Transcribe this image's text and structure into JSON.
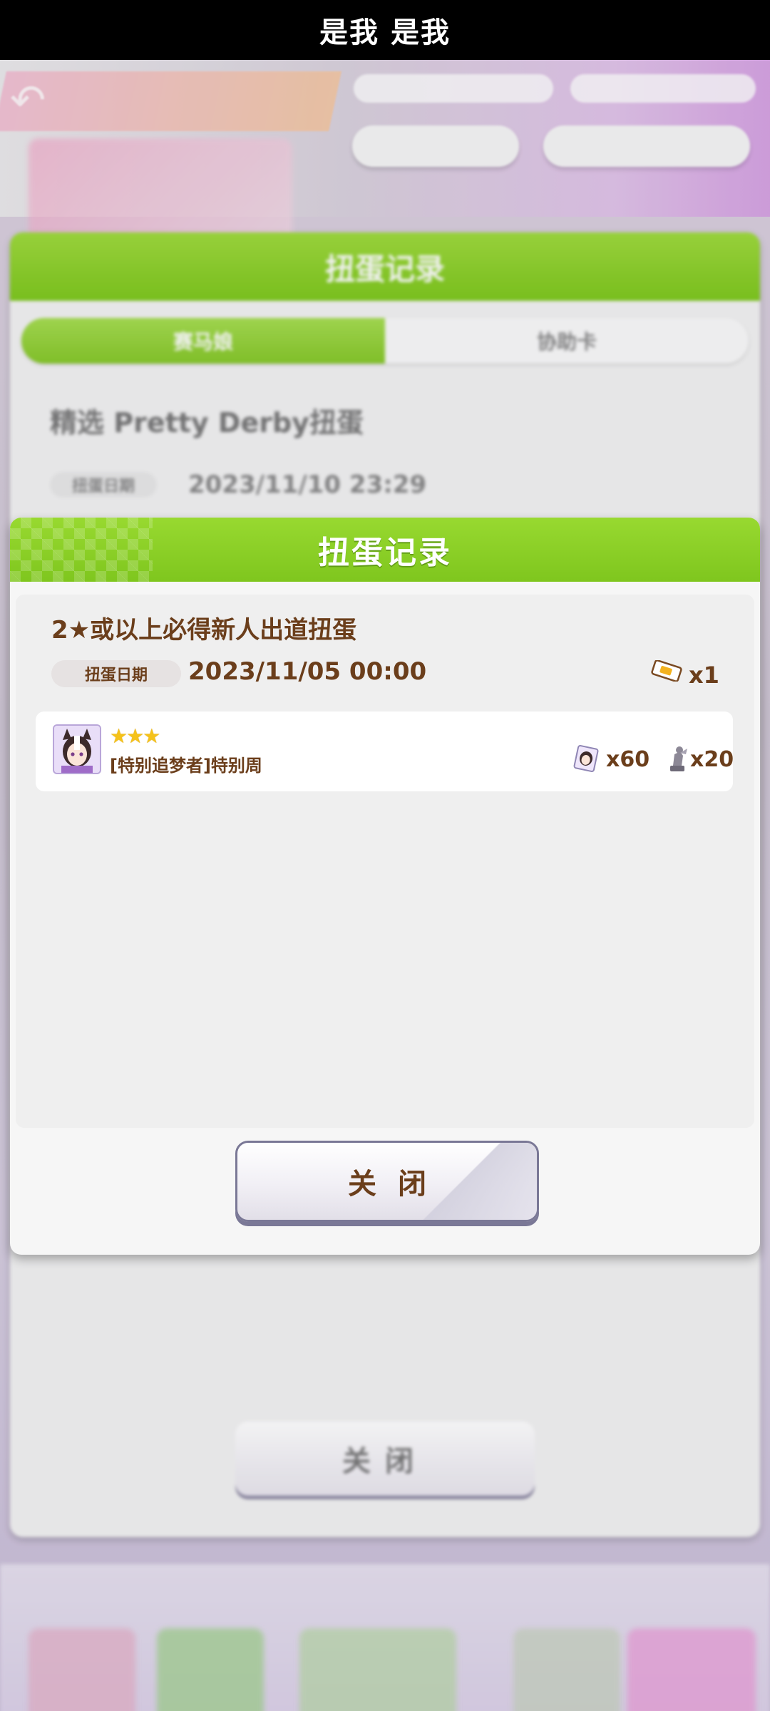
{
  "status_bar": {
    "text": "是我 是我"
  },
  "background": {
    "dialog_title": "扭蛋记录",
    "tabs": [
      "赛马娘",
      "协助卡"
    ],
    "record_title": "精选 Pretty Derby扭蛋",
    "record_date_label": "扭蛋日期",
    "record_date": "2023/11/10 23:29",
    "close_label": "关闭"
  },
  "modal": {
    "title": "扭蛋记录",
    "record": {
      "title": "2★或以上必得新人出道扭蛋",
      "date_label": "扭蛋日期",
      "date": "2023/11/05 00:00",
      "ticket_count": "x1"
    },
    "results": [
      {
        "stars": "★★★",
        "name": "[特别追梦者]特别周",
        "reward1_count": "x60",
        "reward2_count": "x20"
      }
    ],
    "close_label": "关闭"
  },
  "colors": {
    "header_green": "#7fc61e",
    "text_brown": "#6b3e1b",
    "star_gold": "#f5c21a"
  }
}
